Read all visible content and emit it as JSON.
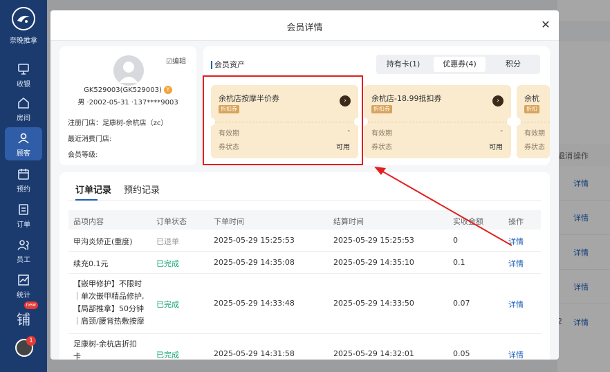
{
  "sidebar": {
    "brand": "奈晚推拿",
    "items": [
      {
        "label": "收银",
        "icon": "monitor-icon"
      },
      {
        "label": "房间",
        "icon": "home-icon"
      },
      {
        "label": "顾客",
        "icon": "user-icon",
        "active": true
      },
      {
        "label": "预约",
        "icon": "calendar-icon"
      },
      {
        "label": "订单",
        "icon": "order-icon"
      },
      {
        "label": "员工",
        "icon": "staff-icon"
      },
      {
        "label": "统计",
        "icon": "chart-icon"
      }
    ],
    "extra_badge": "new",
    "extra_glyph": "铺",
    "notification_count": "1"
  },
  "background": {
    "col_left": "退消",
    "col_right": "操作",
    "detail_link": "详情",
    "partial_number": "2"
  },
  "modal": {
    "title": "会员详情",
    "member": {
      "edit_label": "编辑",
      "id_line": "GK529003(GK529003)",
      "vip_badge": "Y",
      "sub_line": "男 ·2002-05-31 ·137****9003",
      "store_label": "注册门店：足康树-余杭店（zc）",
      "last_store_label": "最近消费门店:",
      "level_label": "会员等级:"
    },
    "assets": {
      "title": "会员资产",
      "tabs": [
        {
          "label": "持有卡(1)"
        },
        {
          "label": "优惠券(4)",
          "active": true
        },
        {
          "label": "积分"
        }
      ],
      "coupons": [
        {
          "name": "余杭店按摩半价券",
          "tag": "折扣券",
          "validity_label": "有效期",
          "validity_value": "-",
          "status_label": "券状态",
          "status_value": "可用"
        },
        {
          "name": "余杭店-18.99抵扣券",
          "tag": "折扣券",
          "validity_label": "有效期",
          "validity_value": "-",
          "status_label": "券状态",
          "status_value": "可用"
        },
        {
          "name": "余杭",
          "tag": "折扣",
          "validity_label": "有效期",
          "validity_value": "",
          "status_label": "券状态",
          "status_value": ""
        }
      ]
    },
    "orders": {
      "tabs": [
        "订单记录",
        "预约记录"
      ],
      "columns": [
        "品项内容",
        "订单状态",
        "下单时间",
        "结算时间",
        "实收金额",
        "操作"
      ],
      "rows": [
        {
          "item": "甲沟炎矫正(重度)",
          "status": "已退单",
          "order_time": "2025-05-29 15:25:53",
          "settle_time": "2025-05-29 15:25:53",
          "amount": "0",
          "action": "详情"
        },
        {
          "item": "续充0.1元",
          "status": "已完成",
          "order_time": "2025-05-29 14:35:08",
          "settle_time": "2025-05-29 14:35:10",
          "amount": "0.1",
          "action": "详情"
        },
        {
          "item_lines": [
            "【嵌甲修护】不限时",
            "｜单次嵌甲精品修护,",
            "【局部推拿】50分钟",
            "｜肩颈/腰背热敷按摩"
          ],
          "status": "已完成",
          "order_time": "2025-05-29 14:33:48",
          "settle_time": "2025-05-29 14:33:50",
          "amount": "0.07",
          "action": "详情"
        },
        {
          "item_lines": [
            "足康树-余杭店折扣",
            "卡"
          ],
          "status": "已完成",
          "order_time": "2025-05-29 14:31:58",
          "settle_time": "2025-05-29 14:32:01",
          "amount": "0.05",
          "action": "详情"
        }
      ]
    }
  },
  "colors": {
    "nav_bg": "#1b3b6f",
    "coupon_bg": "#faebcf",
    "highlight": "#e21f1f",
    "done": "#17a673",
    "link": "#1e5fb8"
  }
}
